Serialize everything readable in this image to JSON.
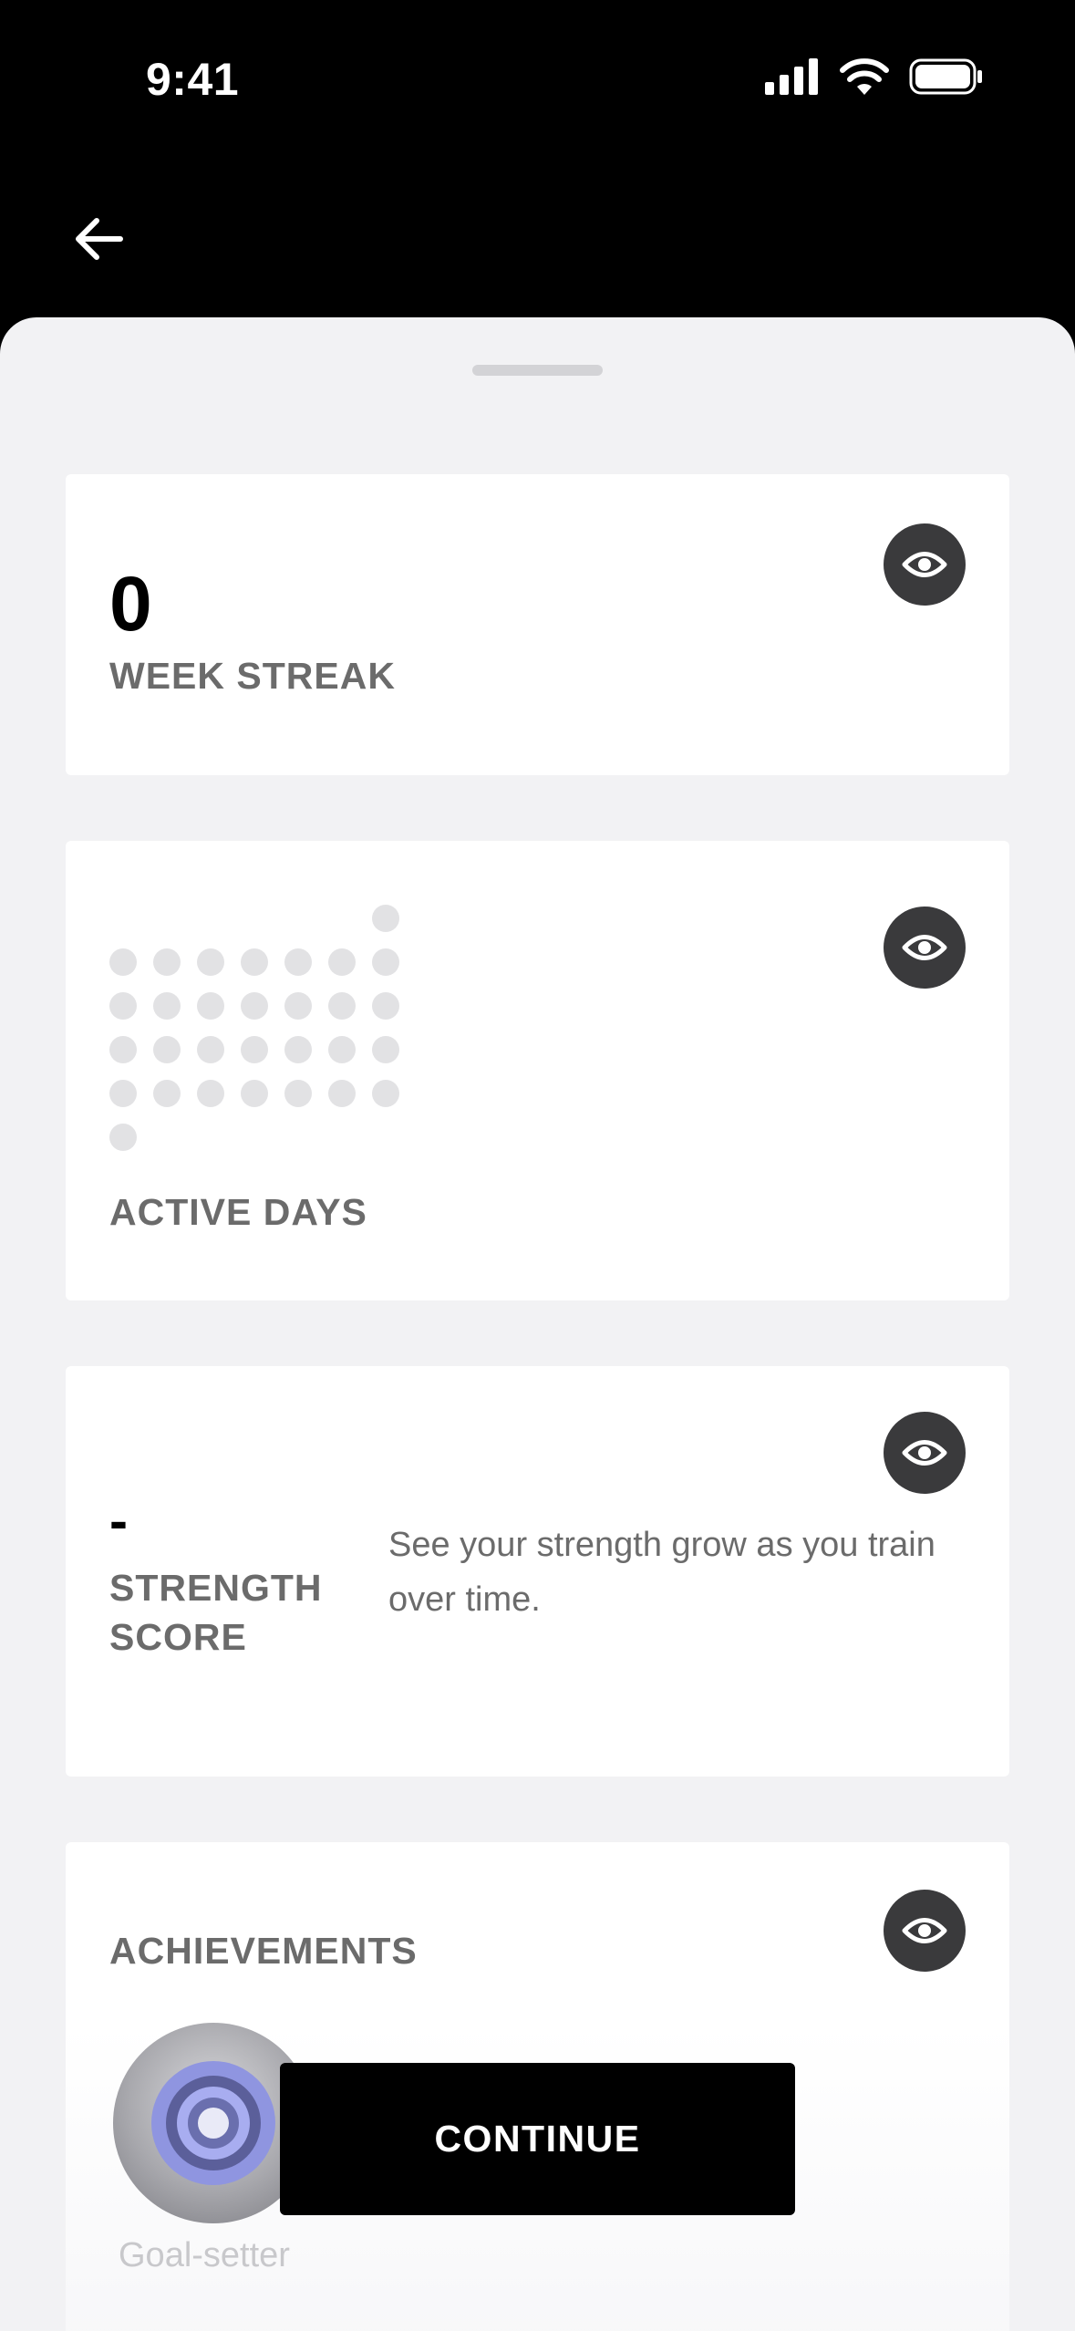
{
  "status_bar": {
    "time": "9:41"
  },
  "streak_card": {
    "value": "0",
    "label": "WEEK STREAK"
  },
  "active_days_card": {
    "label": "ACTIVE DAYS"
  },
  "strength_card": {
    "value": "-",
    "label_line1": "STRENGTH",
    "label_line2": "SCORE",
    "description": "See your strength grow as you train over time."
  },
  "achievements_card": {
    "label": "ACHIEVEMENTS",
    "badge_name": "Goal-setter"
  },
  "continue_button": {
    "label": "CONTINUE"
  },
  "icons": {
    "back": "arrow-left-icon",
    "visibility": "eye-icon"
  }
}
